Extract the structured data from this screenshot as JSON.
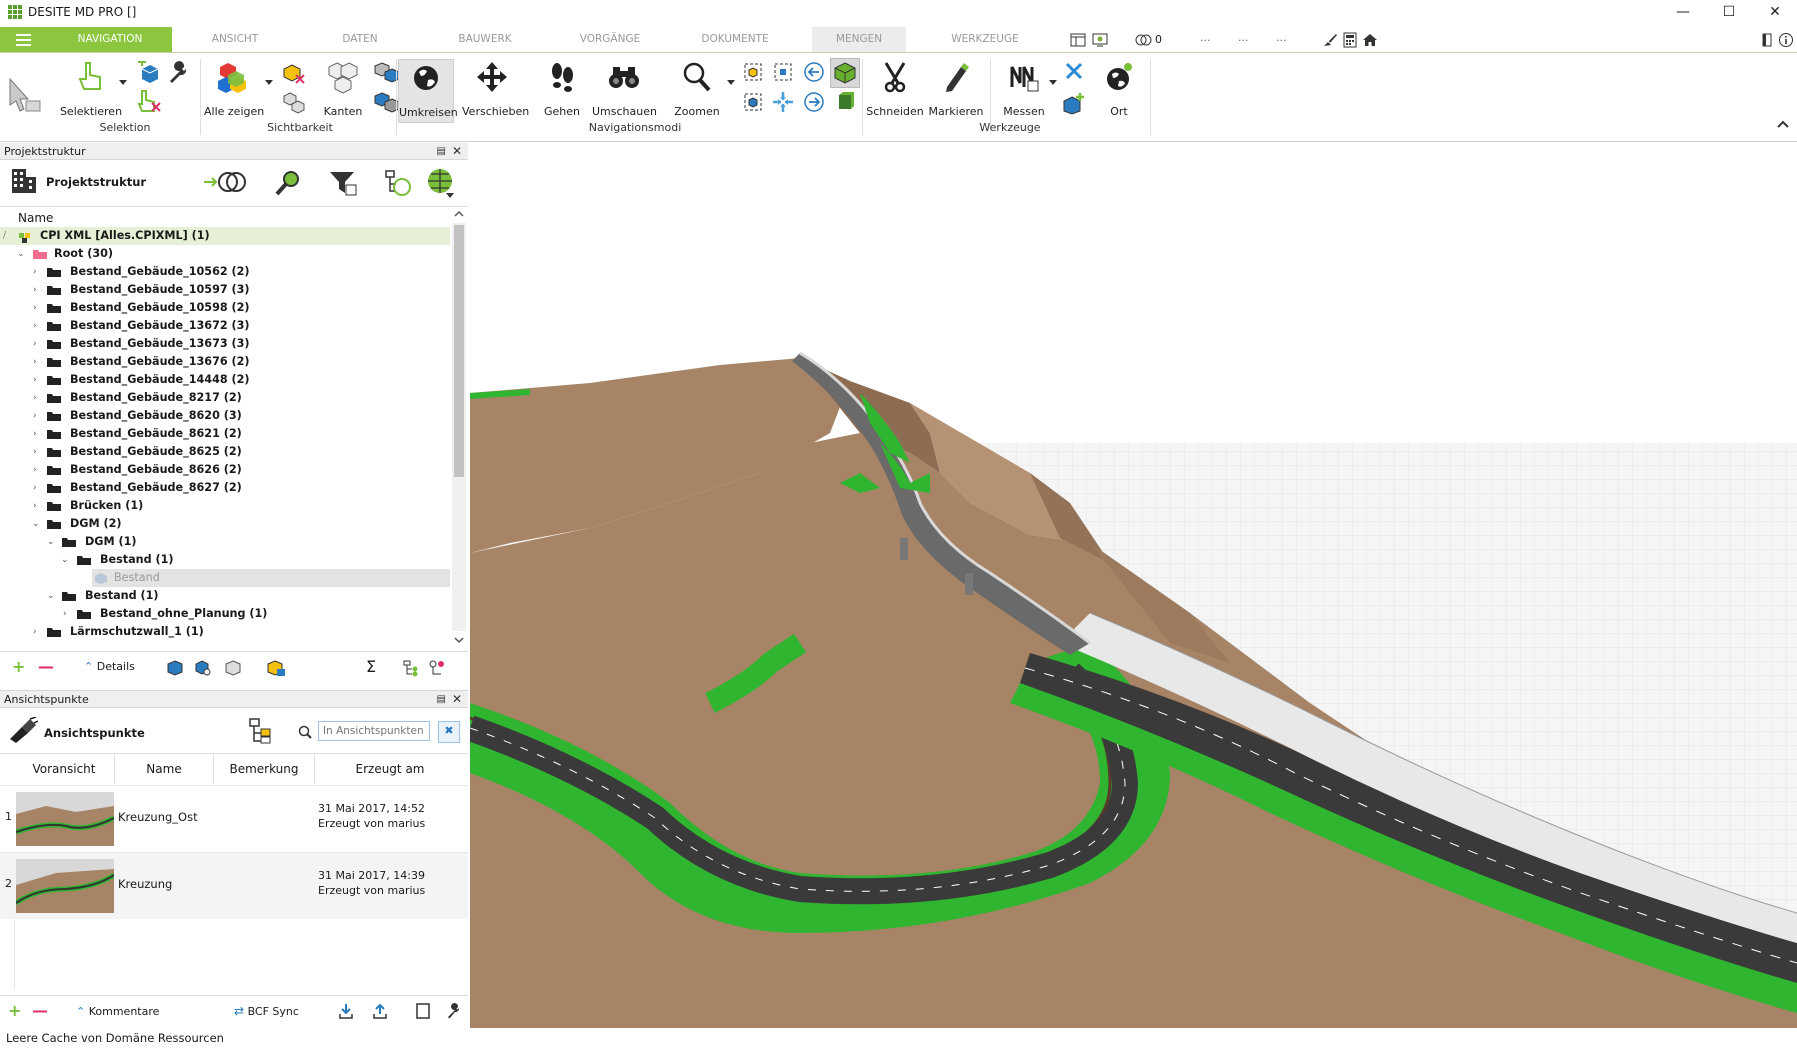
{
  "window": {
    "title": "DESITE MD PRO []"
  },
  "tabs": [
    "NAVIGATION",
    "ANSICHT",
    "DATEN",
    "BAUWERK",
    "VORGÄNGE",
    "DOKUMENTE",
    "MENGEN",
    "WERKZEUGE"
  ],
  "tab_extra": {
    "count": "0",
    "dots1": "...",
    "dots2": "...",
    "dots3": "..."
  },
  "ribbon": {
    "buttons": {
      "selektieren": "Selektieren",
      "alle_zeigen": "Alle zeigen",
      "kanten": "Kanten",
      "umkreisen": "Umkreisen",
      "verschieben": "Verschieben",
      "gehen": "Gehen",
      "umschauen": "Umschauen",
      "zoomen": "Zoomen",
      "schneiden": "Schneiden",
      "markieren": "Markieren",
      "messen": "Messen",
      "ort": "Ort"
    },
    "groups": {
      "selektion": "Selektion",
      "sichtbarkeit": "Sichtbarkeit",
      "navigationsmodi": "Navigationsmodi",
      "werkzeuge": "Werkzeuge"
    }
  },
  "project_panel": {
    "header": "Projektstruktur",
    "toolbar_title": "Projektstruktur",
    "column_name": "Name",
    "tree": [
      "CPI XML [Alles.CPIXML] (1)",
      "Root (30)",
      "Bestand_Gebäude_10562 (2)",
      "Bestand_Gebäude_10597 (3)",
      "Bestand_Gebäude_10598 (2)",
      "Bestand_Gebäude_13672 (3)",
      "Bestand_Gebäude_13673 (3)",
      "Bestand_Gebäude_13676 (2)",
      "Bestand_Gebäude_14448 (2)",
      "Bestand_Gebäude_8217 (2)",
      "Bestand_Gebäude_8620 (3)",
      "Bestand_Gebäude_8621 (2)",
      "Bestand_Gebäude_8625 (2)",
      "Bestand_Gebäude_8626 (2)",
      "Bestand_Gebäude_8627 (2)",
      "Brücken (1)",
      "DGM (2)",
      "DGM (1)",
      "Bestand (1)",
      "Bestand",
      "Bestand (1)",
      "Bestand_ohne_Planung (1)",
      "Lärmschutzwall_1 (1)"
    ],
    "bottom_details": "Details",
    "sigma": "Σ"
  },
  "viewpoints_panel": {
    "header": "Ansichtspunkte",
    "toolbar_title": "Ansichtspunkte",
    "search_placeholder": "In Ansichtspunkten s...",
    "columns": [
      "Voransicht",
      "Name",
      "Bemerkung",
      "Erzeugt am"
    ],
    "rows": [
      {
        "num": "1",
        "name": "Kreuzung_Ost",
        "remark": "",
        "date": "31 Mai 2017, 14:52",
        "by": "Erzeugt von marius"
      },
      {
        "num": "2",
        "name": "Kreuzung",
        "remark": "",
        "date": "31 Mai 2017, 14:39",
        "by": "Erzeugt von marius"
      }
    ],
    "bottom_comments": "Kommentare",
    "bottom_bcf": "BCF Sync"
  },
  "status_bar": {
    "text": "Leere Cache von Domäne Ressourcen"
  },
  "colors": {
    "accent": "#8cc63f",
    "terrain": "#a88466",
    "road": "#3a3a3a",
    "embankment": "#2fb52f"
  }
}
